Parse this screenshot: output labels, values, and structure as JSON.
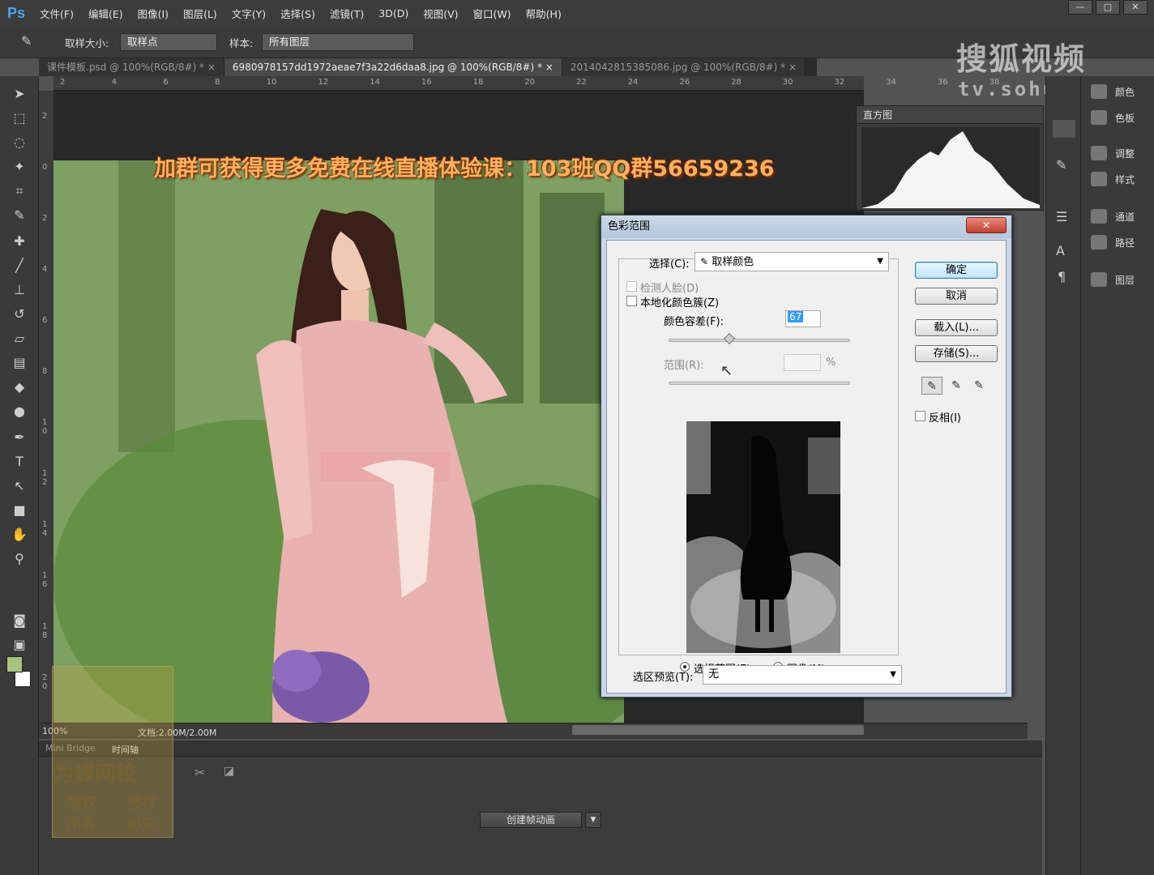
{
  "app": {
    "logo": "Ps"
  },
  "menu": [
    "文件(F)",
    "编辑(E)",
    "图像(I)",
    "图层(L)",
    "文字(Y)",
    "选择(S)",
    "滤镜(T)",
    "3D(D)",
    "视图(V)",
    "窗口(W)",
    "帮助(H)"
  ],
  "window_buttons": [
    "—",
    "▢",
    "✕"
  ],
  "options": {
    "size_label": "取样大小:",
    "size_value": "取样点",
    "sample_label": "样本:",
    "sample_value": "所有图层"
  },
  "tabs": [
    "课件模板.psd @ 100%(RGB/8#) *",
    "6980978157dd1972aeae7f3a22d6daa8.jpg @ 100%(RGB/8#) *",
    "2014042815385086.jpg @ 100%(RGB/8#) *"
  ],
  "tab_close": "×",
  "ruler_top": [
    "2",
    "4",
    "6",
    "8",
    "10",
    "12",
    "14",
    "16",
    "18",
    "20",
    "22",
    "24",
    "26",
    "28",
    "30",
    "32",
    "34",
    "36",
    "38"
  ],
  "ruler_left": [
    "2",
    "0",
    "2",
    "4",
    "6",
    "8",
    "1 0",
    "1 2",
    "1 4",
    "1 6",
    "1 8",
    "2 0"
  ],
  "banner": "加群可获得更多免费在线直播体验课：103班QQ群56659236",
  "status": {
    "zoom": "100%",
    "doc": "文档:2.00M/2.00M"
  },
  "histogram": {
    "title": "直方图"
  },
  "right_panels": [
    "颜色",
    "色板",
    "调整",
    "样式",
    "通道",
    "路径",
    "图层"
  ],
  "watermark": {
    "brand": "搜狐视频",
    "url": "tv.sohu.com"
  },
  "bottom": {
    "tabs": [
      "Mini Bridge",
      "时间轴"
    ],
    "create_button": "创建帧动画"
  },
  "stamp": {
    "line1": "为课网校",
    "line2a": "版权",
    "line2b": "侵权",
    "line3a": "所有",
    "line3b": "必究"
  },
  "colors": {
    "fg": "#a7c47f",
    "bg": "#ffffff"
  },
  "dialog": {
    "title": "色彩范围",
    "close": "✕",
    "select_label": "选择(C):",
    "select_value": "取样颜色",
    "detect_faces": "检测人脸(D)",
    "localized": "本地化颜色簇(Z)",
    "fuzziness_label": "颜色容差(F):",
    "fuzziness_value": "67",
    "range_label": "范围(R):",
    "range_value": "",
    "percent": "%",
    "radio_selection": "选择范围(E)",
    "radio_image": "图像(M)",
    "preview_label": "选区预览(T):",
    "preview_value": "无",
    "ok": "确定",
    "cancel": "取消",
    "load": "载入(L)...",
    "save": "存储(S)...",
    "invert": "反相(I)"
  }
}
